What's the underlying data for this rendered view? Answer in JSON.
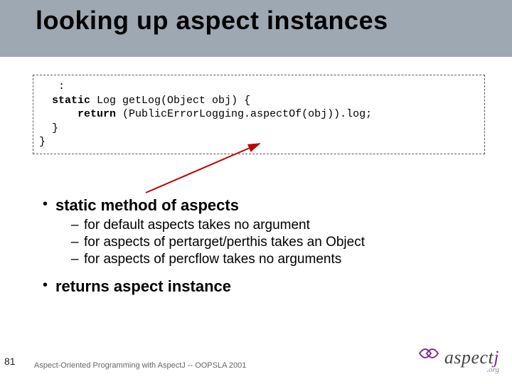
{
  "title": "looking up aspect instances",
  "code": {
    "line1": "   :",
    "line2_pre": "  ",
    "line2_kw1": "static",
    "line2_mid": " Log getLog(Object obj) {",
    "line3_pre": "      ",
    "line3_kw": "return",
    "line3_rest": " (PublicErrorLogging.aspectOf(obj)).log;",
    "line4": "  }",
    "line5": "}"
  },
  "bullets": [
    {
      "text": "static method of aspects",
      "subs": [
        "for default aspects takes no argument",
        "for aspects of pertarget/perthis takes an Object",
        "for aspects of percflow takes no arguments"
      ]
    },
    {
      "text": "returns aspect instance",
      "subs": []
    }
  ],
  "page_number": "81",
  "footer": "Aspect-Oriented Programming with AspectJ -- OOPSLA 2001",
  "logo": {
    "text_left": "aspect",
    "text_j": "j",
    "sub": ".org"
  }
}
